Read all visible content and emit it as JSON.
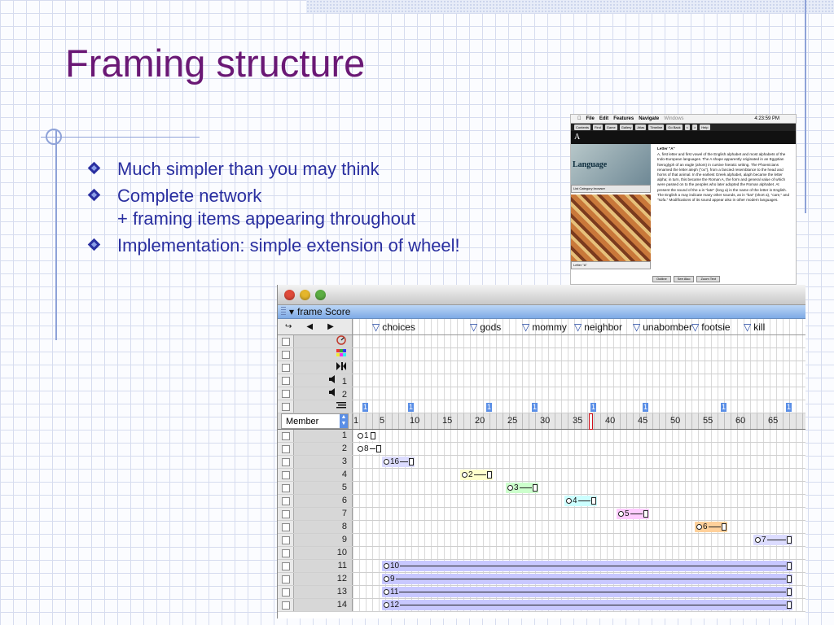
{
  "slide": {
    "title": "Framing structure",
    "bullets": [
      {
        "line1": "Much simpler than you may think",
        "line2": ""
      },
      {
        "line1": "Complete network",
        "line2": "+ framing items appearing throughout"
      },
      {
        "line1": "Implementation: simple extension of wheel!",
        "line2": ""
      }
    ]
  },
  "encyclopedia": {
    "menu": [
      "File",
      "Edit",
      "Features",
      "Navigate",
      "Windows"
    ],
    "clock": "4:23:59 PM",
    "toolbar": [
      "Contents",
      "Find",
      "Game",
      "Gallery",
      "Atlas",
      "Timeline",
      "Go Back",
      "<",
      ">",
      "Help"
    ],
    "heading": "A",
    "image_caption": "Language",
    "tabs": "List  Category browser",
    "letter_caption": "Letter \"A\"",
    "entry_title": "Letter \"A\"",
    "entry_text": "A, first letter and first vowel of the English alphabet and most alphabets of the Indo-European languages. The A shape apparently originated in an Egyptian hieroglyph of an eagle (ahom) in cursive hieratic writing. The Phoenicians renamed the letter aleph (\"ox\"), from a fancied resemblance to the head and horns of that animal. In the earliest Greek alphabet, alaph became the letter alpha; in turn, this became the Roman A, the form and general value of which were passed on to the peoples who later adopted the Roman alphabet. At present the sound of the a in \"late\" (long a) is the name of the letter in English. The English a may indicate many other sounds, as in \"bat\" (short a), \"care,\" and \"sofa.\" Modifications of its sound appear also in other modern languages.",
    "footer": [
      "Outline",
      "See Also",
      "Zoom Text"
    ]
  },
  "score_window": {
    "title": "frame Score",
    "marker_names": [
      "choices",
      "gods",
      "mommy",
      "neighbor",
      "unabomber",
      "footsie",
      "kill"
    ],
    "marker_frames": [
      5,
      20,
      28,
      36,
      45,
      54,
      62
    ],
    "effect_channels": [
      "",
      "",
      "",
      "1",
      "2",
      ""
    ],
    "script_cues": [
      2,
      9,
      21,
      28,
      37,
      45,
      57,
      67
    ],
    "script_cue_label": "1",
    "ruler_labels": [
      "1",
      "5",
      "10",
      "15",
      "20",
      "25",
      "30",
      "35",
      "40",
      "45",
      "50",
      "55",
      "60",
      "65"
    ],
    "ruler_frames": [
      1,
      5,
      10,
      15,
      20,
      25,
      30,
      35,
      40,
      45,
      50,
      55,
      60,
      65
    ],
    "playhead_frame": 37,
    "member_label": "Member",
    "channels": [
      "1",
      "2",
      "3",
      "4",
      "5",
      "6",
      "7",
      "8",
      "9",
      "10",
      "11",
      "12",
      "13",
      "14"
    ],
    "sprites": [
      {
        "channel": 1,
        "start": 1,
        "end": 3,
        "label": "1",
        "color": "#ffffff"
      },
      {
        "channel": 2,
        "start": 1,
        "end": 4,
        "label": "8",
        "color": "#ffffff"
      },
      {
        "channel": 3,
        "start": 5,
        "end": 9,
        "label": "16",
        "color": "#dcdcff"
      },
      {
        "channel": 4,
        "start": 17,
        "end": 21,
        "label": "2",
        "color": "#ffffcc"
      },
      {
        "channel": 5,
        "start": 24,
        "end": 28,
        "label": "3",
        "color": "#ccffcc"
      },
      {
        "channel": 6,
        "start": 33,
        "end": 37,
        "label": "4",
        "color": "#ccffff"
      },
      {
        "channel": 7,
        "start": 41,
        "end": 45,
        "label": "5",
        "color": "#ffccff"
      },
      {
        "channel": 8,
        "start": 53,
        "end": 57,
        "label": "6",
        "color": "#ffd09a"
      },
      {
        "channel": 9,
        "start": 62,
        "end": 67,
        "label": "7",
        "color": "#dcdcff"
      },
      {
        "channel": 11,
        "start": 5,
        "end": 67,
        "label": "10",
        "color": "#c8c8ff"
      },
      {
        "channel": 12,
        "start": 5,
        "end": 67,
        "label": "9",
        "color": "#c8c8ff"
      },
      {
        "channel": 13,
        "start": 5,
        "end": 67,
        "label": "11",
        "color": "#c8c8ff"
      },
      {
        "channel": 14,
        "start": 5,
        "end": 67,
        "label": "12",
        "color": "#c8c8ff"
      }
    ]
  }
}
